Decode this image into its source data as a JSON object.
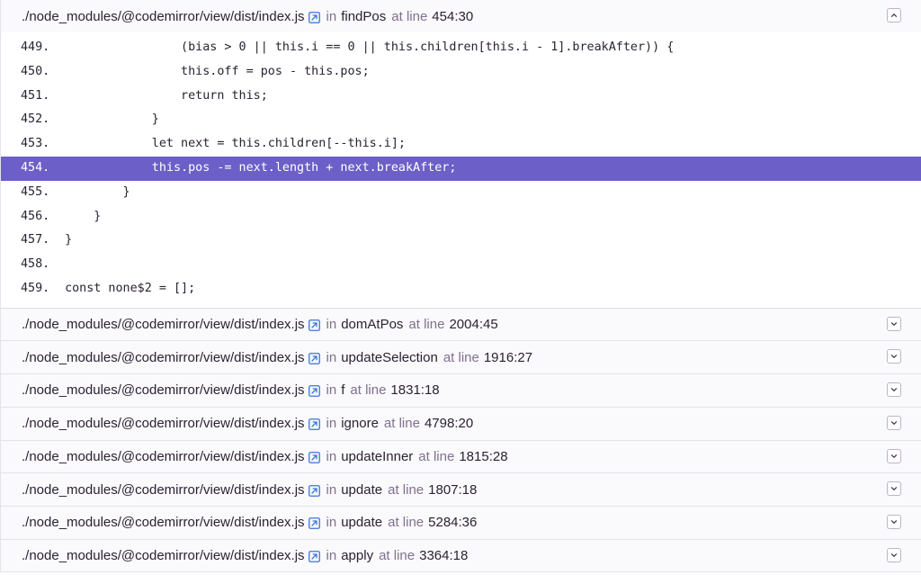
{
  "frames": [
    {
      "path": "./node_modules/@codemirror/view/dist/index.js",
      "in": "in",
      "fn": "findPos",
      "at": "at line",
      "line": "454:30",
      "expanded": true
    },
    {
      "path": "./node_modules/@codemirror/view/dist/index.js",
      "in": "in",
      "fn": "domAtPos",
      "at": "at line",
      "line": "2004:45",
      "expanded": false
    },
    {
      "path": "./node_modules/@codemirror/view/dist/index.js",
      "in": "in",
      "fn": "updateSelection",
      "at": "at line",
      "line": "1916:27",
      "expanded": false
    },
    {
      "path": "./node_modules/@codemirror/view/dist/index.js",
      "in": "in",
      "fn": "f",
      "at": "at line",
      "line": "1831:18",
      "expanded": false
    },
    {
      "path": "./node_modules/@codemirror/view/dist/index.js",
      "in": "in",
      "fn": "ignore",
      "at": "at line",
      "line": "4798:20",
      "expanded": false
    },
    {
      "path": "./node_modules/@codemirror/view/dist/index.js",
      "in": "in",
      "fn": "updateInner",
      "at": "at line",
      "line": "1815:28",
      "expanded": false
    },
    {
      "path": "./node_modules/@codemirror/view/dist/index.js",
      "in": "in",
      "fn": "update",
      "at": "at line",
      "line": "1807:18",
      "expanded": false
    },
    {
      "path": "./node_modules/@codemirror/view/dist/index.js",
      "in": "in",
      "fn": "update",
      "at": "at line",
      "line": "5284:36",
      "expanded": false
    },
    {
      "path": "./node_modules/@codemirror/view/dist/index.js",
      "in": "in",
      "fn": "apply",
      "at": "at line",
      "line": "3364:18",
      "expanded": false
    }
  ],
  "code": [
    {
      "num": "449.",
      "text": "            (bias > 0 || this.i == 0 || this.children[this.i - 1].breakAfter)) {",
      "active": false
    },
    {
      "num": "450.",
      "text": "            this.off = pos - this.pos;",
      "active": false
    },
    {
      "num": "451.",
      "text": "            return this;",
      "active": false
    },
    {
      "num": "452.",
      "text": "        }",
      "active": false
    },
    {
      "num": "453.",
      "text": "        let next = this.children[--this.i];",
      "active": false
    },
    {
      "num": "454.",
      "text": "        this.pos -= next.length + next.breakAfter;",
      "active": true
    },
    {
      "num": "455.",
      "text": "    }",
      "active": false
    },
    {
      "num": "456.",
      "text": "}",
      "active": false
    },
    {
      "num": "457.",
      "text": "}",
      "active": false
    },
    {
      "num": "458.",
      "text": "",
      "active": false
    },
    {
      "num": "459.",
      "text": "const none$2 = [];",
      "active": false
    }
  ],
  "colors": {
    "highlight": "#6c5fc7",
    "link_icon": "#3d74db",
    "muted": "#80708f"
  },
  "icons": {
    "external": "external-link-icon",
    "collapse": "chevron-up-icon",
    "expand": "chevron-down-icon"
  }
}
